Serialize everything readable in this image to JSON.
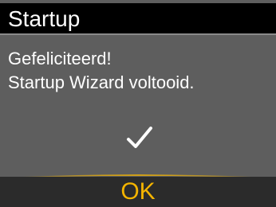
{
  "header": {
    "title": "Startup"
  },
  "message": {
    "line1": "Gefeliciteerd!",
    "line2": "Startup Wizard voltooid."
  },
  "status_icon": "checkmark-icon",
  "softkey": {
    "label": "OK"
  },
  "colors": {
    "background": "#5e5e5e",
    "title_bar": "#000000",
    "softkey_bar": "#2b2b2b",
    "accent": "#f4b400",
    "text": "#ffffff"
  }
}
